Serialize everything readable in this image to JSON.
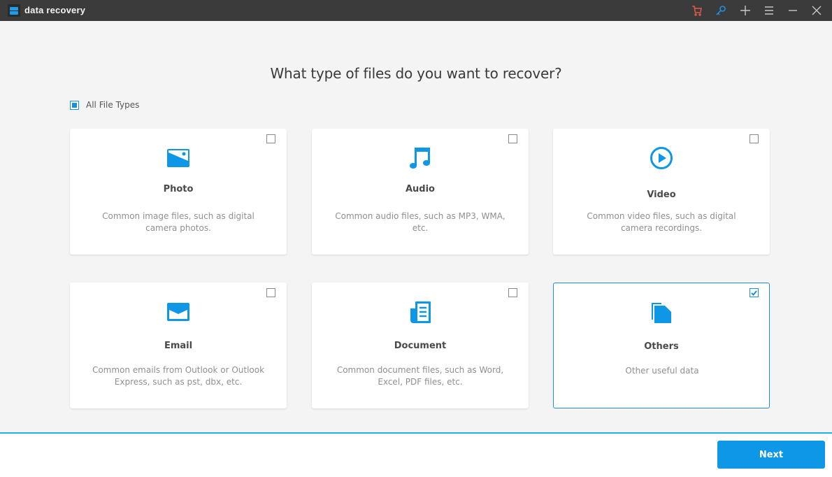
{
  "app": {
    "title": "data recovery"
  },
  "titlebar": {
    "icons": [
      {
        "name": "cart-icon",
        "color": "#e05a47"
      },
      {
        "name": "key-icon",
        "color": "#1e8fe0"
      },
      {
        "name": "plus-icon",
        "color": "#c8c8c8"
      },
      {
        "name": "menu-icon",
        "color": "#c8c8c8"
      },
      {
        "name": "minimize-icon",
        "color": "#c8c8c8"
      },
      {
        "name": "close-icon",
        "color": "#c8c8c8"
      }
    ]
  },
  "main": {
    "heading": "What type of files do you want to recover?",
    "all_file_types": {
      "label": "All File Types",
      "state": "partial"
    },
    "cards": [
      {
        "id": "photo",
        "title": "Photo",
        "description": "Common image files, such as digital camera photos.",
        "checked": false,
        "icon": "photo-icon"
      },
      {
        "id": "audio",
        "title": "Audio",
        "description": "Common audio files, such as MP3, WMA, etc.",
        "checked": false,
        "icon": "music-note-icon"
      },
      {
        "id": "video",
        "title": "Video",
        "description": "Common video files, such as digital camera recordings.",
        "checked": false,
        "icon": "play-circle-icon"
      },
      {
        "id": "email",
        "title": "Email",
        "description": "Common emails from Outlook or Outlook Express, such as pst, dbx, etc.",
        "checked": false,
        "icon": "envelope-icon"
      },
      {
        "id": "document",
        "title": "Document",
        "description": "Common document files, such as Word, Excel, PDF files, etc.",
        "checked": false,
        "icon": "document-icon"
      },
      {
        "id": "others",
        "title": "Others",
        "description": "Other useful data",
        "checked": true,
        "icon": "files-icon"
      }
    ],
    "accent_color": "#1a8fdc"
  },
  "footer": {
    "next_label": "Next"
  }
}
